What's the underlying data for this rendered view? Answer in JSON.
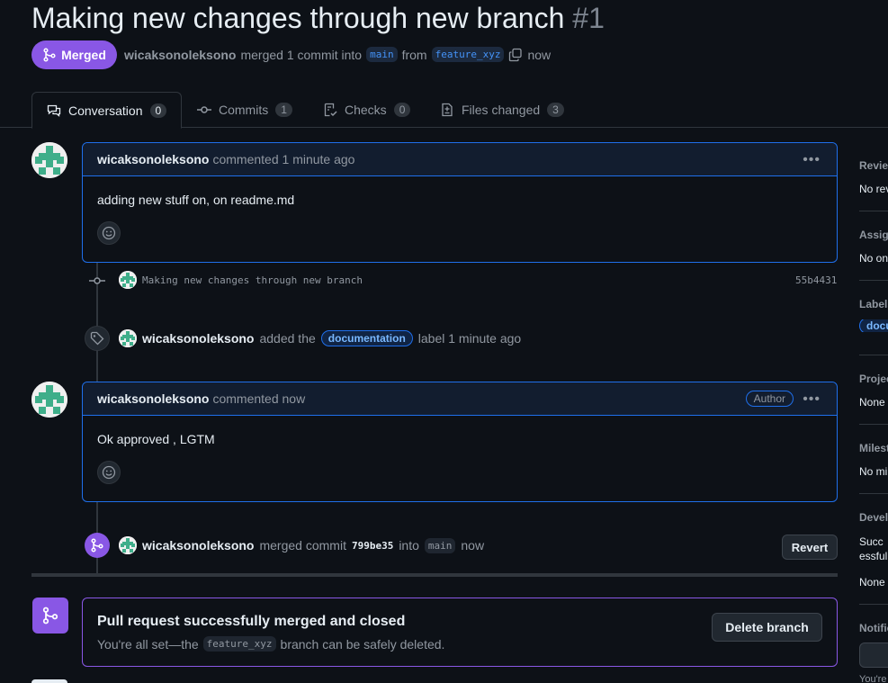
{
  "pr": {
    "title": "Making new changes through new branch",
    "number": "#1",
    "state": "Merged",
    "author": "wicaksonoleksono",
    "merged_text": "merged 1 commit into",
    "base_branch": "main",
    "from_text": "from",
    "head_branch": "feature_xyz",
    "time": "now"
  },
  "tabs": [
    {
      "label": "Conversation",
      "count": "0"
    },
    {
      "label": "Commits",
      "count": "1"
    },
    {
      "label": "Checks",
      "count": "0"
    },
    {
      "label": "Files changed",
      "count": "3"
    }
  ],
  "comments": [
    {
      "user": "wicaksonoleksono",
      "action": "commented 1 minute ago",
      "body": "adding new stuff on, on readme.md",
      "badge": ""
    },
    {
      "user": "wicaksonoleksono",
      "action": "commented now",
      "body": "Ok approved , LGTM",
      "badge": "Author"
    }
  ],
  "commit_event": {
    "message": "Making new changes through new branch",
    "sha": "55b4431"
  },
  "label_event": {
    "user": "wicaksonoleksono",
    "pre": "added the",
    "label": "documentation",
    "post": "label 1 minute ago"
  },
  "merge_event": {
    "user": "wicaksonoleksono",
    "pre": "merged commit",
    "sha": "799be35",
    "mid": "into",
    "branch": "main",
    "time": "now",
    "revert": "Revert"
  },
  "merge_box": {
    "title": "Pull request successfully merged and closed",
    "desc_pre": "You're all set—the",
    "branch": "feature_xyz",
    "desc_post": "branch can be safely deleted.",
    "delete_button": "Delete branch"
  },
  "sidebar": [
    {
      "heading": "Reviewers",
      "value": "No reviews"
    },
    {
      "heading": "Assignees",
      "value": "No one"
    },
    {
      "heading": "Labels",
      "value": "documentation"
    },
    {
      "heading": "Projects",
      "value": "None yet"
    },
    {
      "heading": "Milestone",
      "value": "No milestone"
    },
    {
      "heading": "Development",
      "value": "Successfully merging this pull request may close these issues.",
      "value2": "None yet"
    },
    {
      "heading": "Notifications",
      "value": "You're not receiving notifications"
    }
  ],
  "colors": {
    "merged": "#8957e5",
    "accent": "#1f6feb",
    "bg": "#0d1117"
  }
}
